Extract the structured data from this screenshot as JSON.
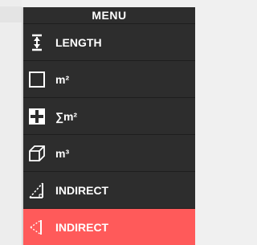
{
  "menu": {
    "title": "MENU",
    "items": [
      {
        "label": "LENGTH",
        "icon": "length-icon"
      },
      {
        "label": "m²",
        "icon": "area-icon"
      },
      {
        "label": "∑m²",
        "icon": "sum-area-icon"
      },
      {
        "label": "m³",
        "icon": "volume-icon"
      },
      {
        "label": "INDIRECT",
        "icon": "indirect-triangle-icon"
      },
      {
        "label": "INDIRECT",
        "icon": "indirect-dashed-icon",
        "active": true
      }
    ]
  },
  "colors": {
    "menu_bg": "#2d2d2d",
    "active_bg": "#ff5a5a",
    "text": "#ffffff"
  }
}
